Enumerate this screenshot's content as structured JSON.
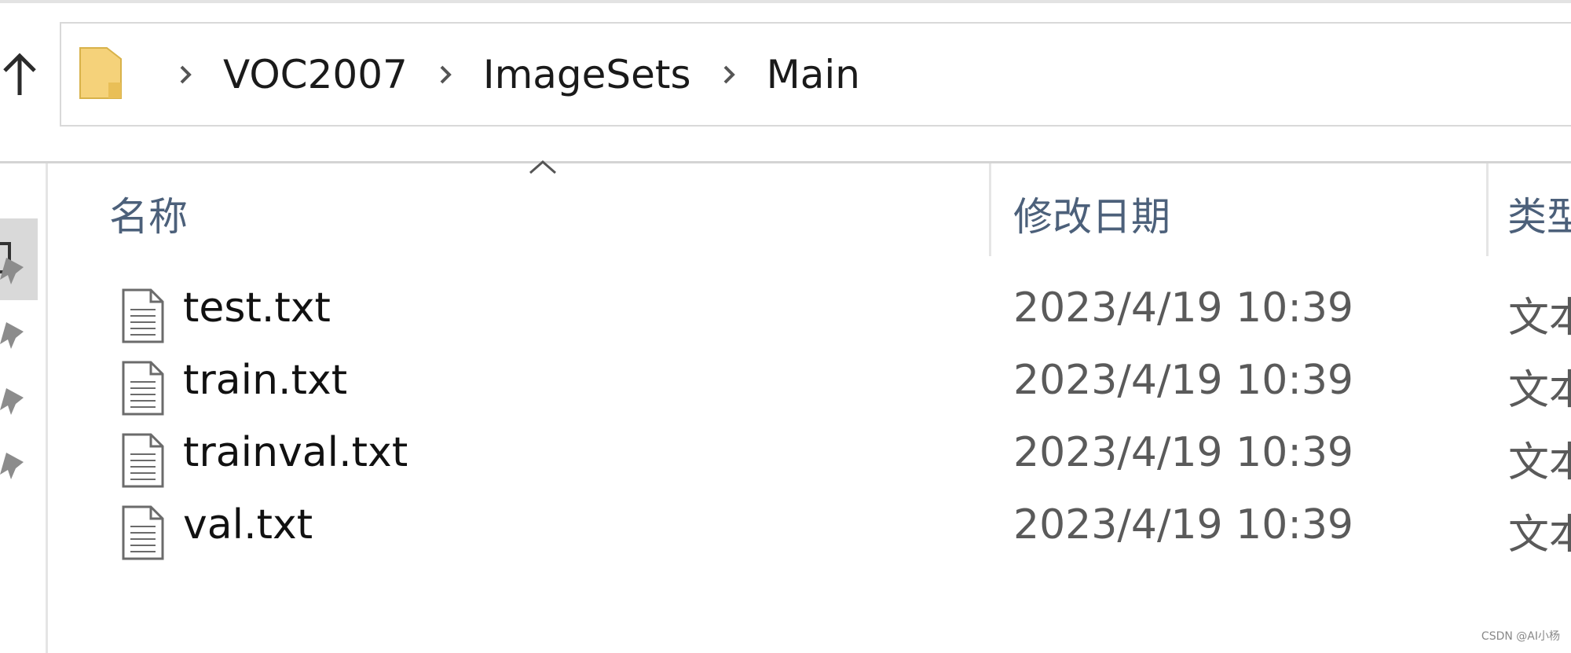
{
  "breadcrumb": {
    "items": [
      "VOC2007",
      "ImageSets",
      "Main"
    ]
  },
  "columns": {
    "name": "名称",
    "date": "修改日期",
    "type": "类型"
  },
  "files": [
    {
      "name": "test.txt",
      "date": "2023/4/19 10:39",
      "type": "文本"
    },
    {
      "name": "train.txt",
      "date": "2023/4/19 10:39",
      "type": "文本"
    },
    {
      "name": "trainval.txt",
      "date": "2023/4/19 10:39",
      "type": "文本"
    },
    {
      "name": "val.txt",
      "date": "2023/4/19 10:39",
      "type": "文本"
    }
  ],
  "icons": {
    "up": "arrow-up-icon",
    "folder": "folder-icon",
    "chevron": "chevron-right-icon",
    "file": "text-file-icon",
    "pin": "pin-icon"
  },
  "colors": {
    "folder": "#f5d27a",
    "header_text": "#4c607a"
  },
  "watermark": "CSDN @AI小杨"
}
